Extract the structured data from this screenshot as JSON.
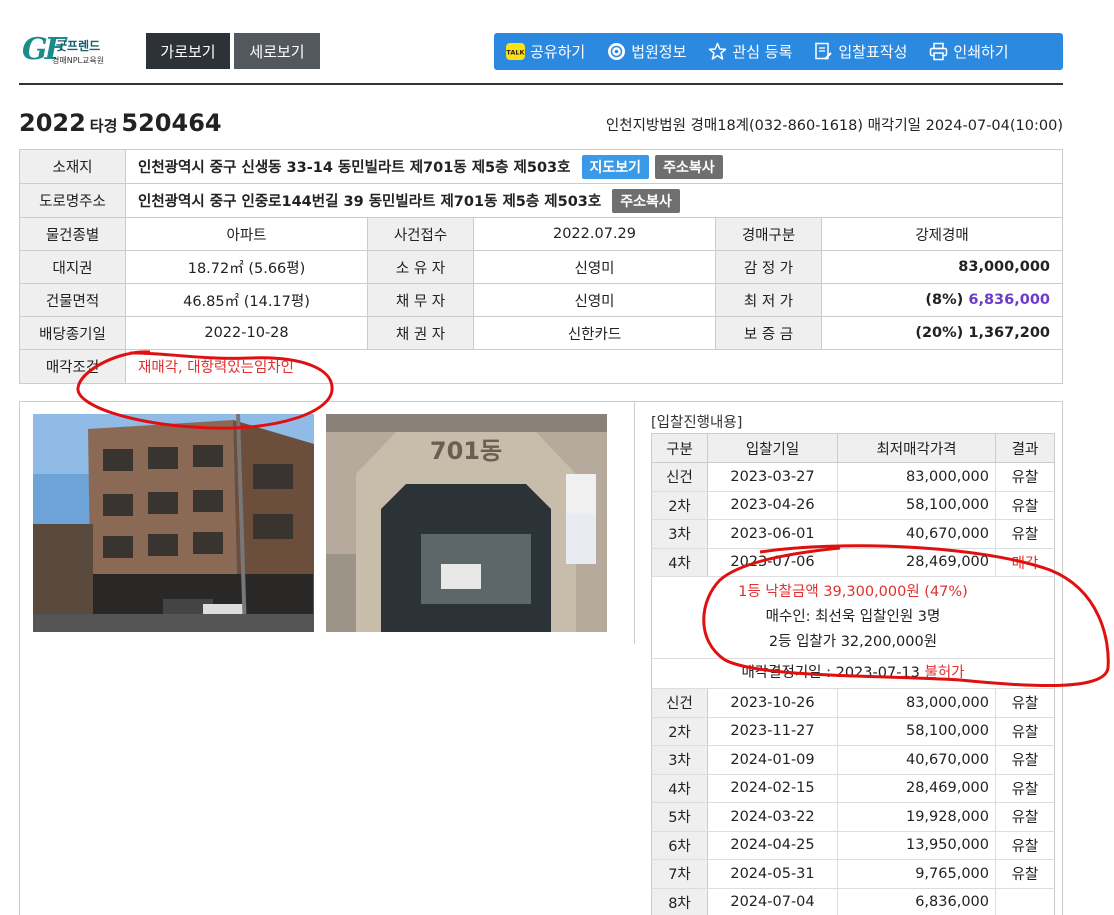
{
  "logo": {
    "mark": "GF",
    "name": "굿프렌드",
    "sub": "경매NPL교육원"
  },
  "view_buttons": [
    "가로보기",
    "세로보기"
  ],
  "toolbar": {
    "share": "공유하기",
    "court_info": "법원정보",
    "watch": "관심 등록",
    "bid_form": "입찰표작성",
    "print": "인쇄하기"
  },
  "case": {
    "year": "2022",
    "kind": "타경",
    "number": "520464",
    "court_info": "인천지방법원 경매18계(032-860-1618) 매각기일 2024-07-04(10:00)"
  },
  "property": {
    "location_label": "소재지",
    "location": "인천광역시 중구 신생동 33-14 동민빌라트 제701동 제5층 제503호",
    "map_btn": "지도보기",
    "copy_btn": "주소복사",
    "road_label": "도로명주소",
    "road": "인천광역시 중구 인중로144번길 39 동민빌라트 제701동 제5층 제503호",
    "rows": [
      {
        "l1": "물건종별",
        "v1": "아파트",
        "l2": "사건접수",
        "v2": "2022.07.29",
        "l3": "경매구분",
        "v3": "강제경매"
      },
      {
        "l1": "대지권",
        "v1": "18.72㎡ (5.66평)",
        "l2": "소 유 자",
        "v2": "신영미",
        "l3": "감 정 가",
        "v3": "83,000,000"
      },
      {
        "l1": "건물면적",
        "v1": "46.85㎡ (14.17평)",
        "l2": "채 무 자",
        "v2": "신영미",
        "l3": "최 저 가",
        "v3_pct": "(8%)",
        "v3": "6,836,000"
      },
      {
        "l1": "배당종기일",
        "v1": "2022-10-28",
        "l2": "채 권 자",
        "v2": "신한카드",
        "l3": "보 증 금",
        "v3_pct": "(20%)",
        "v3": "1,367,200"
      }
    ],
    "cond_label": "매각조건",
    "cond": "재매각, 대항력있는임차인"
  },
  "photos": {
    "sign": "701동"
  },
  "bids": {
    "title": "[입찰진행내용]",
    "headers": [
      "구분",
      "입찰기일",
      "최저매각가격",
      "결과"
    ],
    "first_round": [
      {
        "round": "신건",
        "date": "2023-03-27",
        "price": "83,000,000",
        "result": "유찰"
      },
      {
        "round": "2차",
        "date": "2023-04-26",
        "price": "58,100,000",
        "result": "유찰"
      },
      {
        "round": "3차",
        "date": "2023-06-01",
        "price": "40,670,000",
        "result": "유찰"
      },
      {
        "round": "4차",
        "date": "2023-07-06",
        "price": "28,469,000",
        "result": "매각"
      }
    ],
    "sale_line1": "1등 낙찰금액 39,300,000원 (47%)",
    "sale_line2": "매수인: 최선욱 입찰인원 3명",
    "sale_line3": "2등 입찰가 32,200,000원",
    "decision_prefix": "매각결정기일 : 2023-07-13",
    "decision_result": "불허가",
    "second_round": [
      {
        "round": "신건",
        "date": "2023-10-26",
        "price": "83,000,000",
        "result": "유찰"
      },
      {
        "round": "2차",
        "date": "2023-11-27",
        "price": "58,100,000",
        "result": "유찰"
      },
      {
        "round": "3차",
        "date": "2024-01-09",
        "price": "40,670,000",
        "result": "유찰"
      },
      {
        "round": "4차",
        "date": "2024-02-15",
        "price": "28,469,000",
        "result": "유찰"
      },
      {
        "round": "5차",
        "date": "2024-03-22",
        "price": "19,928,000",
        "result": "유찰"
      },
      {
        "round": "6차",
        "date": "2024-04-25",
        "price": "13,950,000",
        "result": "유찰"
      },
      {
        "round": "7차",
        "date": "2024-05-31",
        "price": "9,765,000",
        "result": "유찰"
      },
      {
        "round": "8차",
        "date": "2024-07-04",
        "price": "6,836,000",
        "result": ""
      }
    ]
  },
  "colors": {
    "accent": "#2b8ae0",
    "sold": "#e03030",
    "min_price": "#6b3cc9",
    "annotation": "#e01010"
  }
}
